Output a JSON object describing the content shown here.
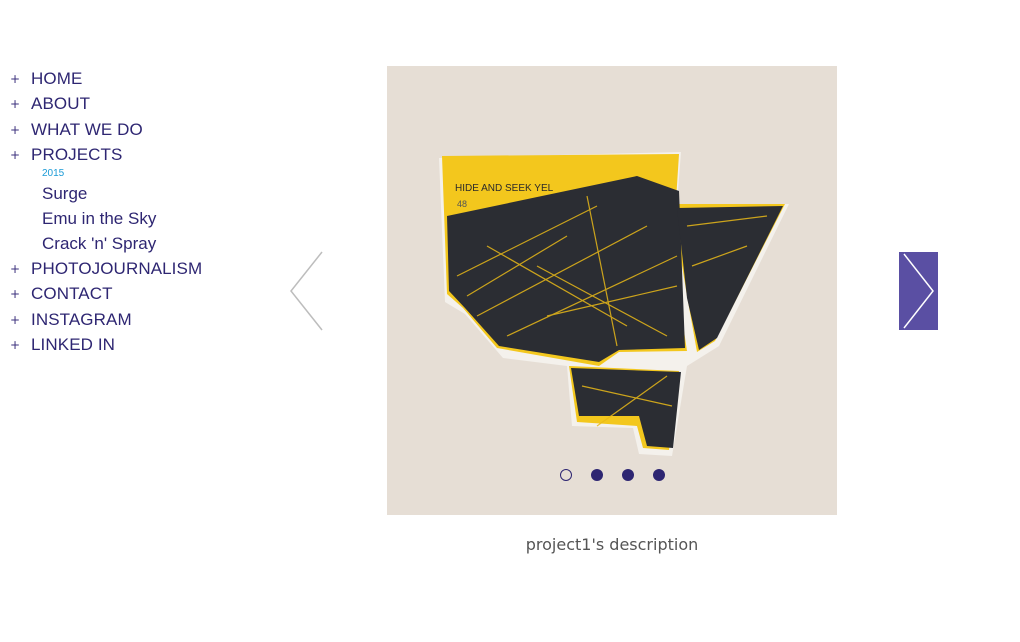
{
  "nav": {
    "plus_symbol": "+",
    "items": [
      {
        "label": "HOME"
      },
      {
        "label": "ABOUT"
      },
      {
        "label": "WHAT WE DO"
      },
      {
        "label": "PROJECTS"
      },
      {
        "label": "PHOTOJOURNALISM"
      },
      {
        "label": "CONTACT"
      },
      {
        "label": "INSTAGRAM"
      },
      {
        "label": "LINKED IN"
      }
    ],
    "projects_year": "2015",
    "projects_sub": [
      {
        "label": "Surge"
      },
      {
        "label": "Emu in the Sky"
      },
      {
        "label": "Crack 'n' Spray"
      }
    ]
  },
  "slider": {
    "artwork_text": "HIDE AND SEEK YEL",
    "artwork_number": "48",
    "active_dot_index": 0,
    "dot_count": 4,
    "prev_icon": "chevron-left-icon",
    "next_icon": "chevron-right-icon",
    "background_color": "#e6ded5",
    "accent_color": "#5a4fa3"
  },
  "caption": "project1's description"
}
